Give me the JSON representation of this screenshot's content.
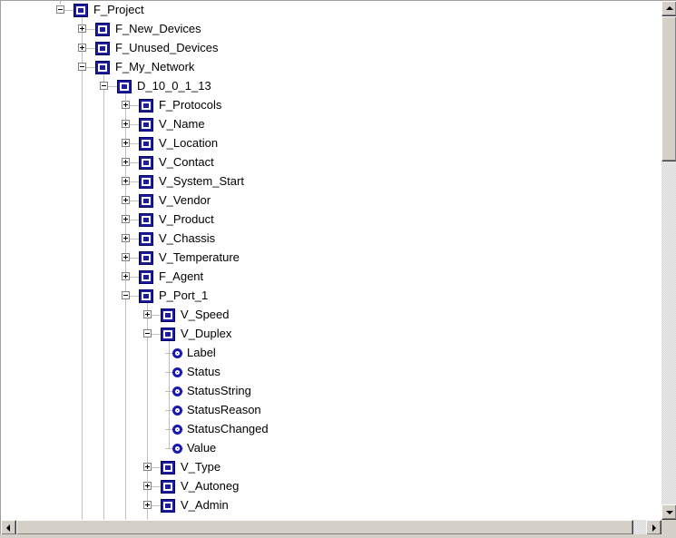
{
  "tree": {
    "nodes": [
      {
        "level": 0,
        "type": "folder",
        "expander": "minus",
        "label": "F_Project"
      },
      {
        "level": 1,
        "type": "folder",
        "expander": "plus",
        "label": "F_New_Devices"
      },
      {
        "level": 1,
        "type": "folder",
        "expander": "plus",
        "label": "F_Unused_Devices"
      },
      {
        "level": 1,
        "type": "folder",
        "expander": "minus",
        "label": "F_My_Network"
      },
      {
        "level": 2,
        "type": "folder",
        "expander": "minus",
        "label": "D_10_0_1_13"
      },
      {
        "level": 3,
        "type": "folder",
        "expander": "plus",
        "label": "F_Protocols"
      },
      {
        "level": 3,
        "type": "folder",
        "expander": "plus",
        "label": "V_Name"
      },
      {
        "level": 3,
        "type": "folder",
        "expander": "plus",
        "label": "V_Location"
      },
      {
        "level": 3,
        "type": "folder",
        "expander": "plus",
        "label": "V_Contact"
      },
      {
        "level": 3,
        "type": "folder",
        "expander": "plus",
        "label": "V_System_Start"
      },
      {
        "level": 3,
        "type": "folder",
        "expander": "plus",
        "label": "V_Vendor"
      },
      {
        "level": 3,
        "type": "folder",
        "expander": "plus",
        "label": "V_Product"
      },
      {
        "level": 3,
        "type": "folder",
        "expander": "plus",
        "label": "V_Chassis"
      },
      {
        "level": 3,
        "type": "folder",
        "expander": "plus",
        "label": "V_Temperature"
      },
      {
        "level": 3,
        "type": "folder",
        "expander": "plus",
        "label": "F_Agent"
      },
      {
        "level": 3,
        "type": "folder",
        "expander": "minus",
        "label": "P_Port_1"
      },
      {
        "level": 4,
        "type": "folder",
        "expander": "plus",
        "label": "V_Speed"
      },
      {
        "level": 4,
        "type": "folder",
        "expander": "minus",
        "label": "V_Duplex"
      },
      {
        "level": 5,
        "type": "leaf",
        "expander": "none",
        "label": "Label"
      },
      {
        "level": 5,
        "type": "leaf",
        "expander": "none",
        "label": "Status"
      },
      {
        "level": 5,
        "type": "leaf",
        "expander": "none",
        "label": "StatusString"
      },
      {
        "level": 5,
        "type": "leaf",
        "expander": "none",
        "label": "StatusReason"
      },
      {
        "level": 5,
        "type": "leaf",
        "expander": "none",
        "label": "StatusChanged"
      },
      {
        "level": 5,
        "type": "leaf",
        "expander": "none",
        "label": "Value"
      },
      {
        "level": 4,
        "type": "folder",
        "expander": "plus",
        "label": "V_Type"
      },
      {
        "level": 4,
        "type": "folder",
        "expander": "plus",
        "label": "V_Autoneg"
      },
      {
        "level": 4,
        "type": "folder",
        "expander": "plus",
        "label": "V_Admin"
      }
    ]
  },
  "icons": {
    "folder": "node-box-icon",
    "leaf": "property-circle-icon",
    "expand": "plus-box-icon",
    "collapse": "minus-box-icon",
    "scroll_up": "up-arrow-icon",
    "scroll_down": "down-arrow-icon",
    "scroll_left": "left-arrow-icon",
    "scroll_right": "right-arrow-icon"
  },
  "colors": {
    "node_icon": "#1c1c9c",
    "leaf_icon": "#1a1ab0",
    "scrollbar_face": "#d4d0c8",
    "tree_lines": "#808080"
  }
}
